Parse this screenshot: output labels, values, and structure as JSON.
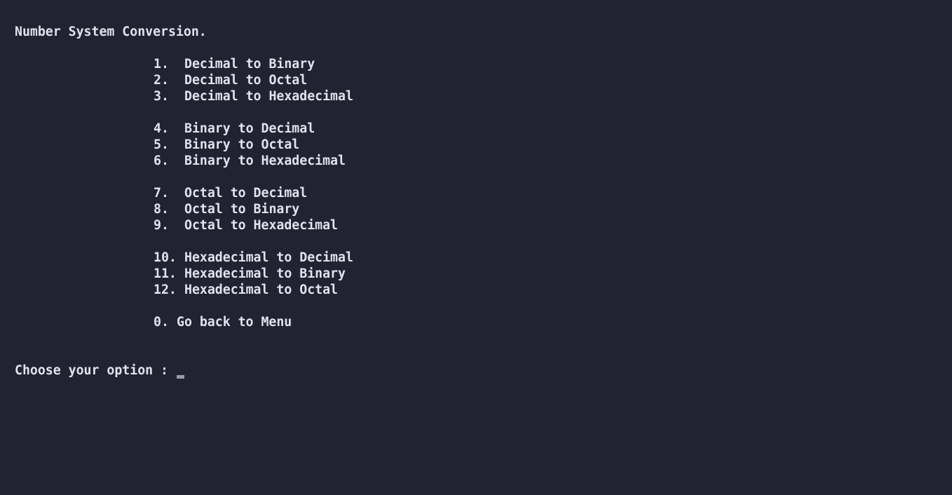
{
  "title": "Number System Conversion.",
  "menu": [
    {
      "num": "1.",
      "label": "Decimal to Binary"
    },
    {
      "num": "2.",
      "label": "Decimal to Octal"
    },
    {
      "num": "3.",
      "label": "Decimal to Hexadecimal"
    },
    {
      "num": "4.",
      "label": "Binary to Decimal"
    },
    {
      "num": "5.",
      "label": "Binary to Octal"
    },
    {
      "num": "6.",
      "label": "Binary to Hexadecimal"
    },
    {
      "num": "7.",
      "label": "Octal to Decimal"
    },
    {
      "num": "8.",
      "label": "Octal to Binary"
    },
    {
      "num": "9.",
      "label": "Octal to Hexadecimal"
    },
    {
      "num": "10.",
      "label": "Hexadecimal to Decimal"
    },
    {
      "num": "11.",
      "label": "Hexadecimal to Binary"
    },
    {
      "num": "12.",
      "label": "Hexadecimal to Octal"
    }
  ],
  "back": {
    "num": "0.",
    "label": "Go back to Menu"
  },
  "prompt": "Choose your option :",
  "colors": {
    "background": "#232232",
    "text": "#e3e3ee",
    "cursor": "#9a9aac"
  }
}
